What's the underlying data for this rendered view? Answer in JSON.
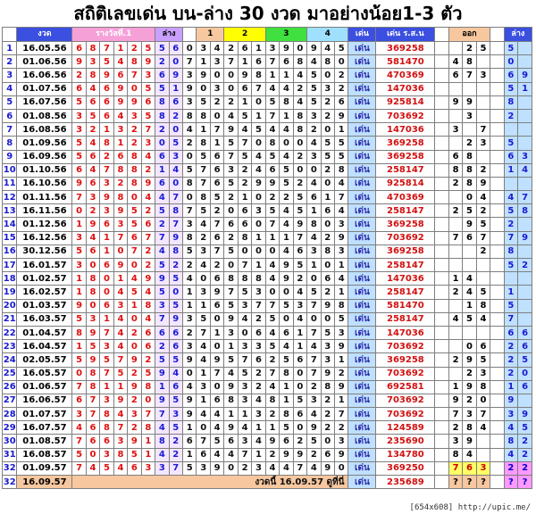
{
  "title": "สถิติเลขเด่น บน-ล่าง 30 งวด มาอย่างน้อย1-3 ตัว",
  "headers": {
    "no": "",
    "date": "งวด",
    "prize": "รางวัลที่.1",
    "lower": "ล่าง",
    "h1": "1",
    "h2": "2",
    "h3": "3",
    "h4": "4",
    "den": "เด่น",
    "num": "เด่น ร.ส.น",
    "out": "ออก",
    "lower2": "ล่าง"
  },
  "colors": {
    "header_blue": "#3b4fe0",
    "header_purple": "#c9a0ff",
    "header_pink": "#f6a0d8",
    "header_orange": "#f7c79f",
    "h1": "#f7c79f",
    "h2": "#ffff00",
    "h3": "#3fe03f",
    "h4": "#9fe0ff",
    "den_cell": "#bfe0ff",
    "lower_cell": "#bfe0ff",
    "yellow_cell": "#ffff66",
    "row_odd": "#ffffff"
  },
  "rows": [
    {
      "no": "1",
      "date": "16.05.56",
      "digits": [
        "6",
        "8",
        "7",
        "1",
        "2",
        "5",
        "5",
        "6",
        "0",
        "3",
        "4",
        "2",
        "6",
        "1",
        "3",
        "9",
        "0",
        "9",
        "4",
        "5"
      ],
      "den": "เด่น",
      "num": "369258",
      "out": [
        "",
        "2",
        "5"
      ],
      "low": [
        "5",
        ""
      ]
    },
    {
      "no": "2",
      "date": "01.06.56",
      "digits": [
        "9",
        "3",
        "5",
        "4",
        "8",
        "9",
        "2",
        "0",
        "7",
        "1",
        "3",
        "7",
        "1",
        "6",
        "7",
        "6",
        "8",
        "4",
        "8",
        "0"
      ],
      "den": "เด่น",
      "num": "581470",
      "out": [
        "4",
        "8",
        ""
      ],
      "low": [
        "0",
        ""
      ]
    },
    {
      "no": "3",
      "date": "16.06.56",
      "digits": [
        "2",
        "8",
        "9",
        "6",
        "7",
        "3",
        "6",
        "9",
        "3",
        "9",
        "0",
        "0",
        "9",
        "8",
        "1",
        "1",
        "4",
        "5",
        "0",
        "2"
      ],
      "den": "เด่น",
      "num": "470369",
      "out": [
        "6",
        "7",
        "3"
      ],
      "low": [
        "6",
        "9"
      ]
    },
    {
      "no": "4",
      "date": "01.07.56",
      "digits": [
        "6",
        "4",
        "6",
        "9",
        "0",
        "5",
        "5",
        "1",
        "9",
        "0",
        "3",
        "0",
        "6",
        "7",
        "4",
        "4",
        "2",
        "5",
        "3",
        "2"
      ],
      "den": "เด่น",
      "num": "147036",
      "out": [
        "",
        "",
        ""
      ],
      "low": [
        "5",
        "1"
      ]
    },
    {
      "no": "5",
      "date": "16.07.56",
      "digits": [
        "5",
        "6",
        "6",
        "9",
        "9",
        "6",
        "8",
        "6",
        "3",
        "5",
        "2",
        "2",
        "1",
        "0",
        "5",
        "8",
        "4",
        "5",
        "2",
        "6"
      ],
      "den": "เด่น",
      "num": "925814",
      "out": [
        "9",
        "9",
        ""
      ],
      "low": [
        "8",
        ""
      ]
    },
    {
      "no": "6",
      "date": "01.08.56",
      "digits": [
        "3",
        "5",
        "6",
        "4",
        "3",
        "5",
        "8",
        "2",
        "8",
        "8",
        "0",
        "4",
        "5",
        "1",
        "7",
        "1",
        "8",
        "3",
        "2",
        "9"
      ],
      "den": "เด่น",
      "num": "703692",
      "out": [
        "",
        "3",
        ""
      ],
      "low": [
        "2",
        ""
      ]
    },
    {
      "no": "7",
      "date": "16.08.56",
      "digits": [
        "3",
        "2",
        "1",
        "3",
        "2",
        "7",
        "2",
        "0",
        "4",
        "1",
        "7",
        "9",
        "4",
        "5",
        "4",
        "4",
        "8",
        "2",
        "0",
        "1"
      ],
      "den": "เด่น",
      "num": "147036",
      "out": [
        "3",
        "",
        "7"
      ],
      "low": [
        "",
        ""
      ]
    },
    {
      "no": "8",
      "date": "01.09.56",
      "digits": [
        "5",
        "4",
        "8",
        "1",
        "2",
        "3",
        "0",
        "5",
        "2",
        "8",
        "1",
        "5",
        "7",
        "0",
        "8",
        "0",
        "0",
        "4",
        "5",
        "5"
      ],
      "den": "เด่น",
      "num": "369258",
      "out": [
        "",
        "2",
        "3"
      ],
      "low": [
        "5",
        ""
      ]
    },
    {
      "no": "9",
      "date": "16.09.56",
      "digits": [
        "5",
        "6",
        "2",
        "6",
        "8",
        "4",
        "6",
        "3",
        "0",
        "5",
        "6",
        "7",
        "5",
        "4",
        "5",
        "4",
        "2",
        "3",
        "5",
        "5"
      ],
      "den": "เด่น",
      "num": "369258",
      "out": [
        "6",
        "8",
        ""
      ],
      "low": [
        "6",
        "3"
      ]
    },
    {
      "no": "10",
      "date": "01.10.56",
      "digits": [
        "6",
        "4",
        "7",
        "8",
        "8",
        "2",
        "1",
        "4",
        "5",
        "7",
        "6",
        "3",
        "2",
        "4",
        "6",
        "5",
        "0",
        "0",
        "2",
        "8"
      ],
      "den": "เด่น",
      "num": "258147",
      "out": [
        "8",
        "8",
        "2"
      ],
      "low": [
        "1",
        "4"
      ]
    },
    {
      "no": "11",
      "date": "16.10.56",
      "digits": [
        "9",
        "6",
        "3",
        "2",
        "8",
        "9",
        "6",
        "0",
        "8",
        "7",
        "6",
        "5",
        "2",
        "9",
        "9",
        "5",
        "2",
        "4",
        "0",
        "4"
      ],
      "den": "เด่น",
      "num": "925814",
      "out": [
        "2",
        "8",
        "9"
      ],
      "low": [
        "",
        ""
      ]
    },
    {
      "no": "12",
      "date": "01.11.56",
      "digits": [
        "7",
        "3",
        "9",
        "8",
        "0",
        "4",
        "4",
        "7",
        "0",
        "8",
        "5",
        "2",
        "1",
        "0",
        "2",
        "2",
        "5",
        "6",
        "1",
        "7"
      ],
      "den": "เด่น",
      "num": "470369",
      "out": [
        "",
        "0",
        "4"
      ],
      "low": [
        "4",
        "7"
      ]
    },
    {
      "no": "13",
      "date": "16.11.56",
      "digits": [
        "0",
        "2",
        "3",
        "9",
        "5",
        "2",
        "5",
        "8",
        "7",
        "5",
        "2",
        "0",
        "6",
        "3",
        "5",
        "4",
        "5",
        "1",
        "6",
        "4"
      ],
      "den": "เด่น",
      "num": "258147",
      "out": [
        "2",
        "5",
        "2"
      ],
      "low": [
        "5",
        "8"
      ]
    },
    {
      "no": "14",
      "date": "01.12.56",
      "digits": [
        "1",
        "9",
        "6",
        "3",
        "5",
        "6",
        "2",
        "7",
        "3",
        "4",
        "7",
        "6",
        "6",
        "0",
        "7",
        "4",
        "9",
        "8",
        "0",
        "3"
      ],
      "den": "เด่น",
      "num": "369258",
      "out": [
        "",
        "9",
        "5"
      ],
      "low": [
        "2",
        ""
      ]
    },
    {
      "no": "15",
      "date": "16.12.56",
      "digits": [
        "3",
        "4",
        "1",
        "7",
        "6",
        "7",
        "7",
        "9",
        "8",
        "2",
        "6",
        "2",
        "8",
        "1",
        "1",
        "1",
        "7",
        "4",
        "2",
        "9"
      ],
      "den": "เด่น",
      "num": "703692",
      "out": [
        "7",
        "6",
        "7"
      ],
      "low": [
        "7",
        "9"
      ]
    },
    {
      "no": "16",
      "date": "30.12.56",
      "digits": [
        "5",
        "6",
        "1",
        "0",
        "7",
        "2",
        "4",
        "8",
        "5",
        "3",
        "7",
        "5",
        "0",
        "0",
        "0",
        "4",
        "6",
        "3",
        "8",
        "3"
      ],
      "den": "เด่น",
      "num": "369258",
      "out": [
        "",
        "",
        "2"
      ],
      "low": [
        "8",
        ""
      ]
    },
    {
      "no": "17",
      "date": "16.01.57",
      "digits": [
        "3",
        "0",
        "6",
        "9",
        "0",
        "2",
        "5",
        "2",
        "2",
        "4",
        "2",
        "0",
        "7",
        "1",
        "4",
        "9",
        "5",
        "1",
        "0",
        "1"
      ],
      "den": "เด่น",
      "num": "258147",
      "out": [
        "",
        "",
        ""
      ],
      "low": [
        "5",
        "2"
      ]
    },
    {
      "no": "18",
      "date": "01.02.57",
      "digits": [
        "1",
        "8",
        "0",
        "1",
        "4",
        "9",
        "9",
        "5",
        "4",
        "0",
        "6",
        "8",
        "8",
        "8",
        "4",
        "9",
        "2",
        "0",
        "6",
        "4"
      ],
      "den": "เด่น",
      "num": "147036",
      "out": [
        "1",
        "4",
        ""
      ],
      "low": [
        "",
        ""
      ]
    },
    {
      "no": "19",
      "date": "16.02.57",
      "digits": [
        "1",
        "8",
        "0",
        "4",
        "5",
        "4",
        "5",
        "0",
        "1",
        "3",
        "9",
        "7",
        "5",
        "3",
        "0",
        "0",
        "4",
        "5",
        "2",
        "1"
      ],
      "den": "เด่น",
      "num": "258147",
      "out": [
        "2",
        "4",
        "5"
      ],
      "low": [
        "1",
        ""
      ]
    },
    {
      "no": "20",
      "date": "01.03.57",
      "digits": [
        "9",
        "0",
        "6",
        "3",
        "1",
        "8",
        "3",
        "5",
        "1",
        "1",
        "6",
        "5",
        "3",
        "7",
        "7",
        "5",
        "3",
        "7",
        "9",
        "8"
      ],
      "den": "เด่น",
      "num": "581470",
      "out": [
        "",
        "1",
        "8"
      ],
      "low": [
        "5",
        ""
      ]
    },
    {
      "no": "21",
      "date": "16.03.57",
      "digits": [
        "5",
        "3",
        "1",
        "4",
        "0",
        "4",
        "7",
        "9",
        "3",
        "5",
        "0",
        "9",
        "4",
        "2",
        "5",
        "0",
        "4",
        "0",
        "0",
        "5"
      ],
      "den": "เด่น",
      "num": "258147",
      "out": [
        "4",
        "5",
        "4"
      ],
      "low": [
        "7",
        ""
      ]
    },
    {
      "no": "22",
      "date": "01.04.57",
      "digits": [
        "8",
        "9",
        "7",
        "4",
        "2",
        "6",
        "6",
        "6",
        "2",
        "7",
        "1",
        "3",
        "0",
        "6",
        "4",
        "6",
        "1",
        "7",
        "5",
        "3"
      ],
      "den": "เด่น",
      "num": "147036",
      "out": [
        "",
        "",
        ""
      ],
      "low": [
        "6",
        "6"
      ]
    },
    {
      "no": "23",
      "date": "16.04.57",
      "digits": [
        "1",
        "5",
        "3",
        "4",
        "0",
        "6",
        "2",
        "6",
        "3",
        "4",
        "0",
        "1",
        "3",
        "3",
        "5",
        "4",
        "1",
        "4",
        "3",
        "9"
      ],
      "den": "เด่น",
      "num": "703692",
      "out": [
        "",
        "0",
        "6"
      ],
      "low": [
        "2",
        "6"
      ]
    },
    {
      "no": "24",
      "date": "02.05.57",
      "digits": [
        "5",
        "9",
        "5",
        "7",
        "9",
        "2",
        "5",
        "5",
        "9",
        "4",
        "9",
        "5",
        "7",
        "6",
        "2",
        "5",
        "6",
        "7",
        "3",
        "1"
      ],
      "den": "เด่น",
      "num": "369258",
      "out": [
        "2",
        "9",
        "5"
      ],
      "low": [
        "2",
        "5"
      ]
    },
    {
      "no": "25",
      "date": "16.05.57",
      "digits": [
        "0",
        "8",
        "7",
        "5",
        "2",
        "5",
        "9",
        "4",
        "0",
        "1",
        "7",
        "4",
        "5",
        "2",
        "7",
        "8",
        "0",
        "7",
        "9",
        "2"
      ],
      "den": "เด่น",
      "num": "703692",
      "out": [
        "",
        "2",
        "3"
      ],
      "low": [
        "2",
        "0"
      ]
    },
    {
      "no": "26",
      "date": "01.06.57",
      "digits": [
        "7",
        "8",
        "1",
        "1",
        "9",
        "8",
        "1",
        "6",
        "4",
        "3",
        "0",
        "9",
        "3",
        "2",
        "4",
        "1",
        "0",
        "2",
        "8",
        "9"
      ],
      "den": "เด่น",
      "num": "692581",
      "out": [
        "1",
        "9",
        "8"
      ],
      "low": [
        "1",
        "6"
      ]
    },
    {
      "no": "27",
      "date": "16.06.57",
      "digits": [
        "6",
        "7",
        "3",
        "9",
        "2",
        "0",
        "9",
        "5",
        "9",
        "1",
        "6",
        "8",
        "3",
        "4",
        "8",
        "1",
        "5",
        "3",
        "2",
        "1"
      ],
      "den": "เด่น",
      "num": "703692",
      "out": [
        "9",
        "2",
        "0"
      ],
      "low": [
        "9",
        ""
      ]
    },
    {
      "no": "28",
      "date": "01.07.57",
      "digits": [
        "3",
        "7",
        "8",
        "4",
        "3",
        "7",
        "7",
        "3",
        "9",
        "4",
        "4",
        "1",
        "1",
        "3",
        "2",
        "8",
        "6",
        "4",
        "2",
        "7"
      ],
      "den": "เด่น",
      "num": "703692",
      "out": [
        "7",
        "3",
        "7"
      ],
      "low": [
        "3",
        "9"
      ]
    },
    {
      "no": "29",
      "date": "16.07.57",
      "digits": [
        "4",
        "6",
        "8",
        "7",
        "2",
        "8",
        "4",
        "5",
        "1",
        "0",
        "4",
        "9",
        "4",
        "1",
        "1",
        "5",
        "0",
        "9",
        "2",
        "2"
      ],
      "den": "เด่น",
      "num": "124589",
      "out": [
        "2",
        "8",
        "4"
      ],
      "low": [
        "4",
        "5"
      ]
    },
    {
      "no": "30",
      "date": "01.08.57",
      "digits": [
        "7",
        "6",
        "6",
        "3",
        "9",
        "1",
        "8",
        "2",
        "6",
        "7",
        "5",
        "6",
        "3",
        "4",
        "9",
        "6",
        "2",
        "5",
        "0",
        "3"
      ],
      "den": "เด่น",
      "num": "235690",
      "out": [
        "3",
        "9",
        ""
      ],
      "low": [
        "8",
        "2"
      ]
    },
    {
      "no": "31",
      "date": "16.08.57",
      "digits": [
        "5",
        "0",
        "3",
        "8",
        "5",
        "1",
        "4",
        "2",
        "1",
        "6",
        "4",
        "4",
        "7",
        "1",
        "2",
        "9",
        "9",
        "2",
        "6",
        "9"
      ],
      "den": "เด่น",
      "num": "134780",
      "out": [
        "8",
        "4",
        ""
      ],
      "low": [
        "4",
        "2"
      ]
    },
    {
      "no": "32",
      "date": "01.09.57",
      "digits": [
        "7",
        "4",
        "5",
        "4",
        "6",
        "3",
        "3",
        "7",
        "5",
        "3",
        "9",
        "0",
        "2",
        "3",
        "4",
        "4",
        "7",
        "4",
        "9",
        "0"
      ],
      "den": "เด่น",
      "num": "369250",
      "out": [
        "7",
        "6",
        "3"
      ],
      "low": [
        "2",
        "2"
      ]
    }
  ],
  "last_row": {
    "no": "32",
    "date": "16.09.57",
    "label": "งวดนี้ 16.09.57 ดูที่นี่",
    "den": "เด่น",
    "num": "235689",
    "out": [
      "?",
      "?",
      "?"
    ],
    "low": [
      "?",
      "?"
    ]
  },
  "footer": "[654x608] http://upic.me/"
}
